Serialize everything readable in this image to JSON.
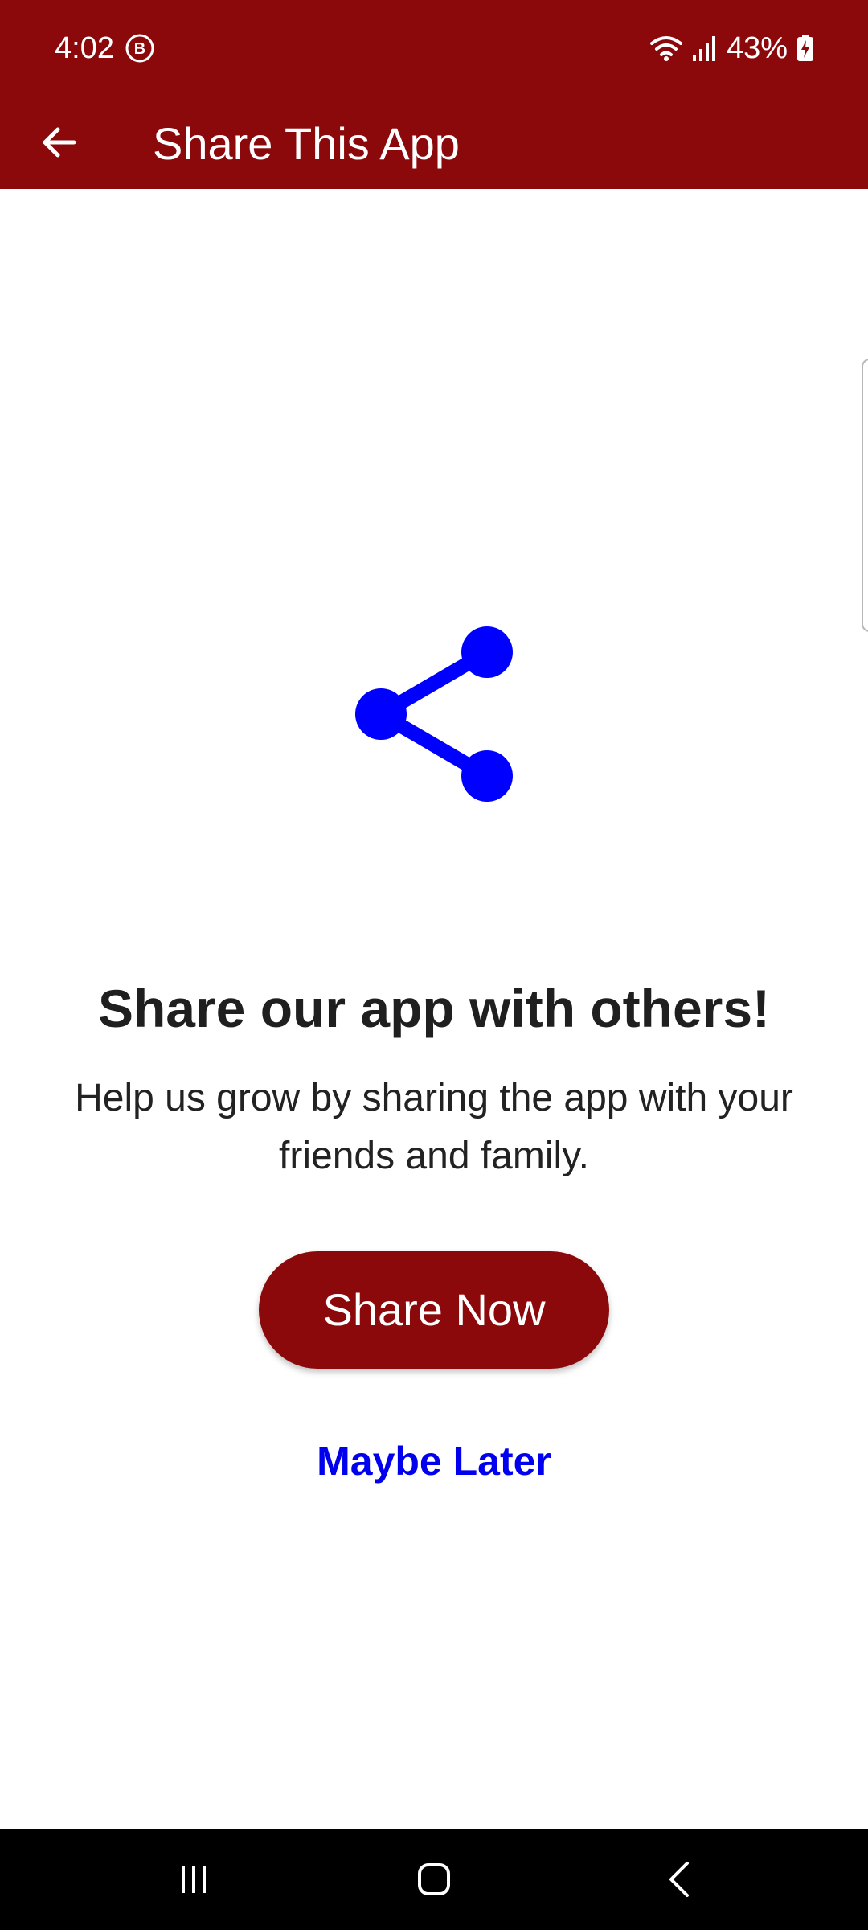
{
  "status_bar": {
    "time": "4:02",
    "battery_percent": "43%",
    "icons": [
      "b-badge-icon",
      "wifi-icon",
      "signal-icon",
      "battery-charging-icon"
    ]
  },
  "app_bar": {
    "back_icon": "arrow-back-icon",
    "title": "Share This App"
  },
  "content": {
    "icon": "share-icon",
    "headline": "Share our app with others!",
    "subtext": "Help us grow by sharing the app with your friends and family.",
    "primary_button": "Share Now",
    "secondary_link": "Maybe Later"
  },
  "nav_bar": {
    "icons": [
      "recent-apps-icon",
      "home-icon",
      "back-icon"
    ]
  },
  "colors": {
    "brand": "#8b080b",
    "accent": "#0000ee",
    "text": "#1f1f1f",
    "background": "#ffffff"
  }
}
